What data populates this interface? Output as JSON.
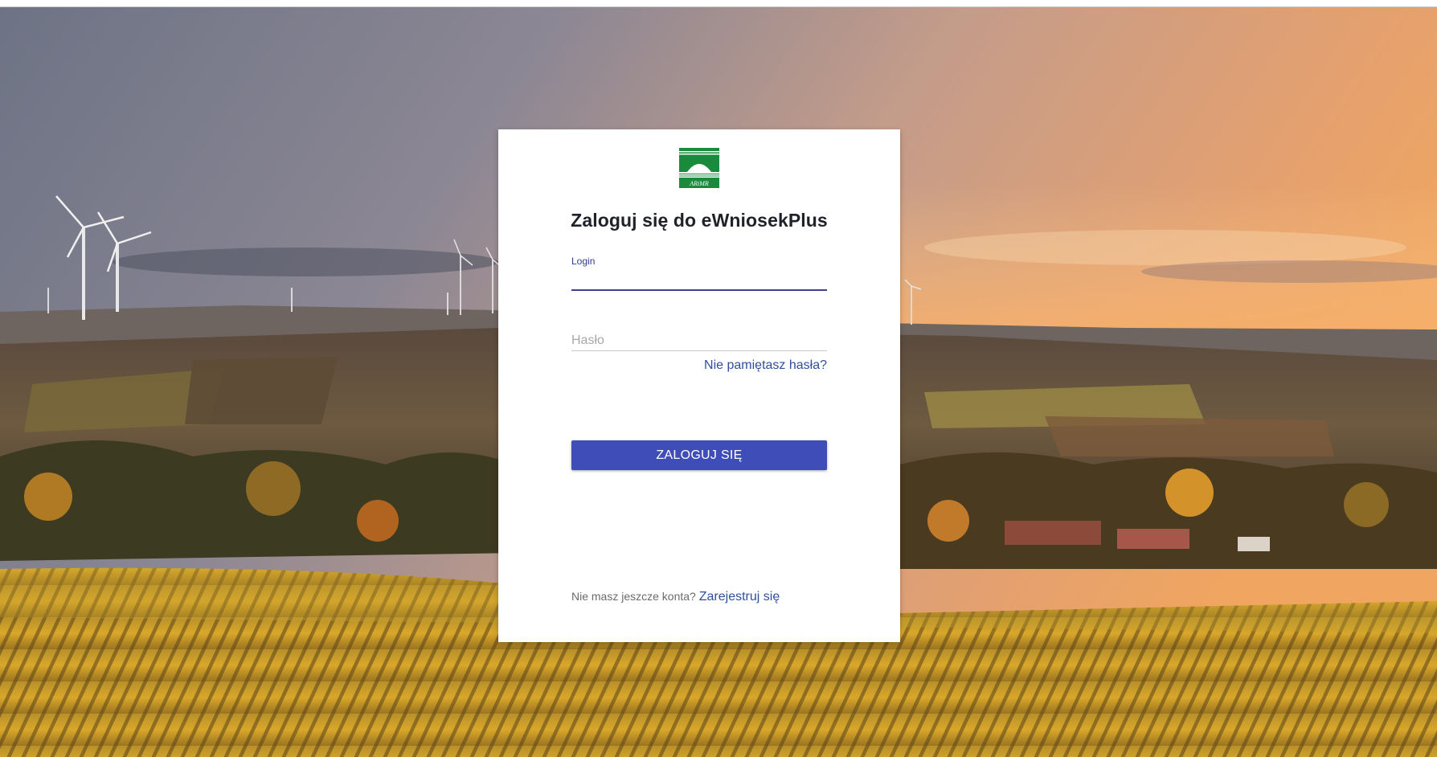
{
  "logo": {
    "text": "ARiMR",
    "color": "#1a8a3c"
  },
  "login_card": {
    "title": "Zaloguj się do eWniosekPlus",
    "login_field": {
      "label": "Login",
      "value": ""
    },
    "password_field": {
      "placeholder": "Hasło",
      "value": ""
    },
    "forgot_password_link": "Nie pamiętasz hasła?",
    "login_button": "ZALOGUJ SIĘ",
    "register_prompt": "Nie masz jeszcze konta?",
    "register_link": "Zarejestruj się"
  },
  "colors": {
    "button": "#3f4db8",
    "link": "#2f4e9b",
    "active_underline": "#3b4287"
  }
}
